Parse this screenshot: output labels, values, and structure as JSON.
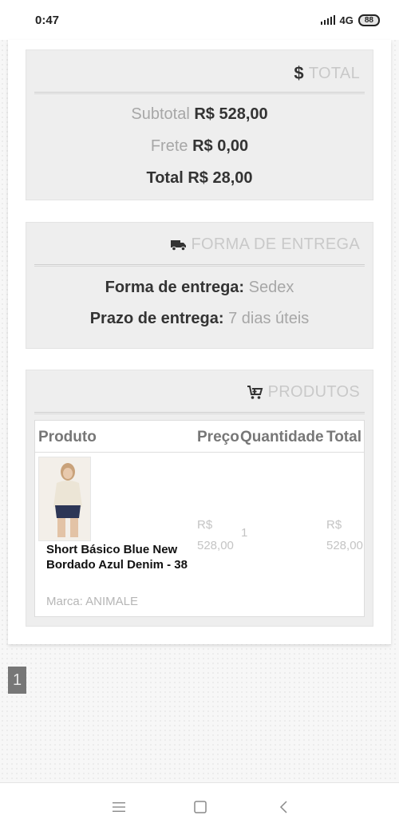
{
  "status_bar": {
    "time": "0:47",
    "network": "4G",
    "battery": "88"
  },
  "total_panel": {
    "title": "TOTAL",
    "icon": "dollar-icon",
    "subtotal_label": "Subtotal",
    "subtotal_value": "R$ 528,00",
    "shipping_label": "Frete",
    "shipping_value": "R$ 0,00",
    "total_label": "Total",
    "total_value": "R$ 28,00"
  },
  "delivery_panel": {
    "title": "FORMA DE ENTREGA",
    "icon": "truck-icon",
    "method_label": "Forma de entrega:",
    "method_value": "Sedex",
    "time_label": "Prazo de entrega:",
    "time_value": "7 dias úteis"
  },
  "products_panel": {
    "title": "PRODUTOS",
    "icon": "cart-icon",
    "columns": [
      "Produto",
      "Preço",
      "Quantidade",
      "Total"
    ],
    "items": [
      {
        "name": "Short Básico Blue New Bordado Azul Denim - 38",
        "brand": "Marca: ANIMALE",
        "price_currency": "R$",
        "price_amount": "528,00",
        "quantity": "1",
        "total_currency": "R$",
        "total_amount": "528,00"
      }
    ]
  },
  "pagination": {
    "current_page": "1"
  },
  "nav_bar": {
    "icons": [
      "menu-icon",
      "home-square-icon",
      "back-chevron-icon"
    ]
  },
  "colors": {
    "panel_bg": "#eeeeee",
    "panel_title": "#c9c9c9",
    "pager_bg": "#777777"
  }
}
